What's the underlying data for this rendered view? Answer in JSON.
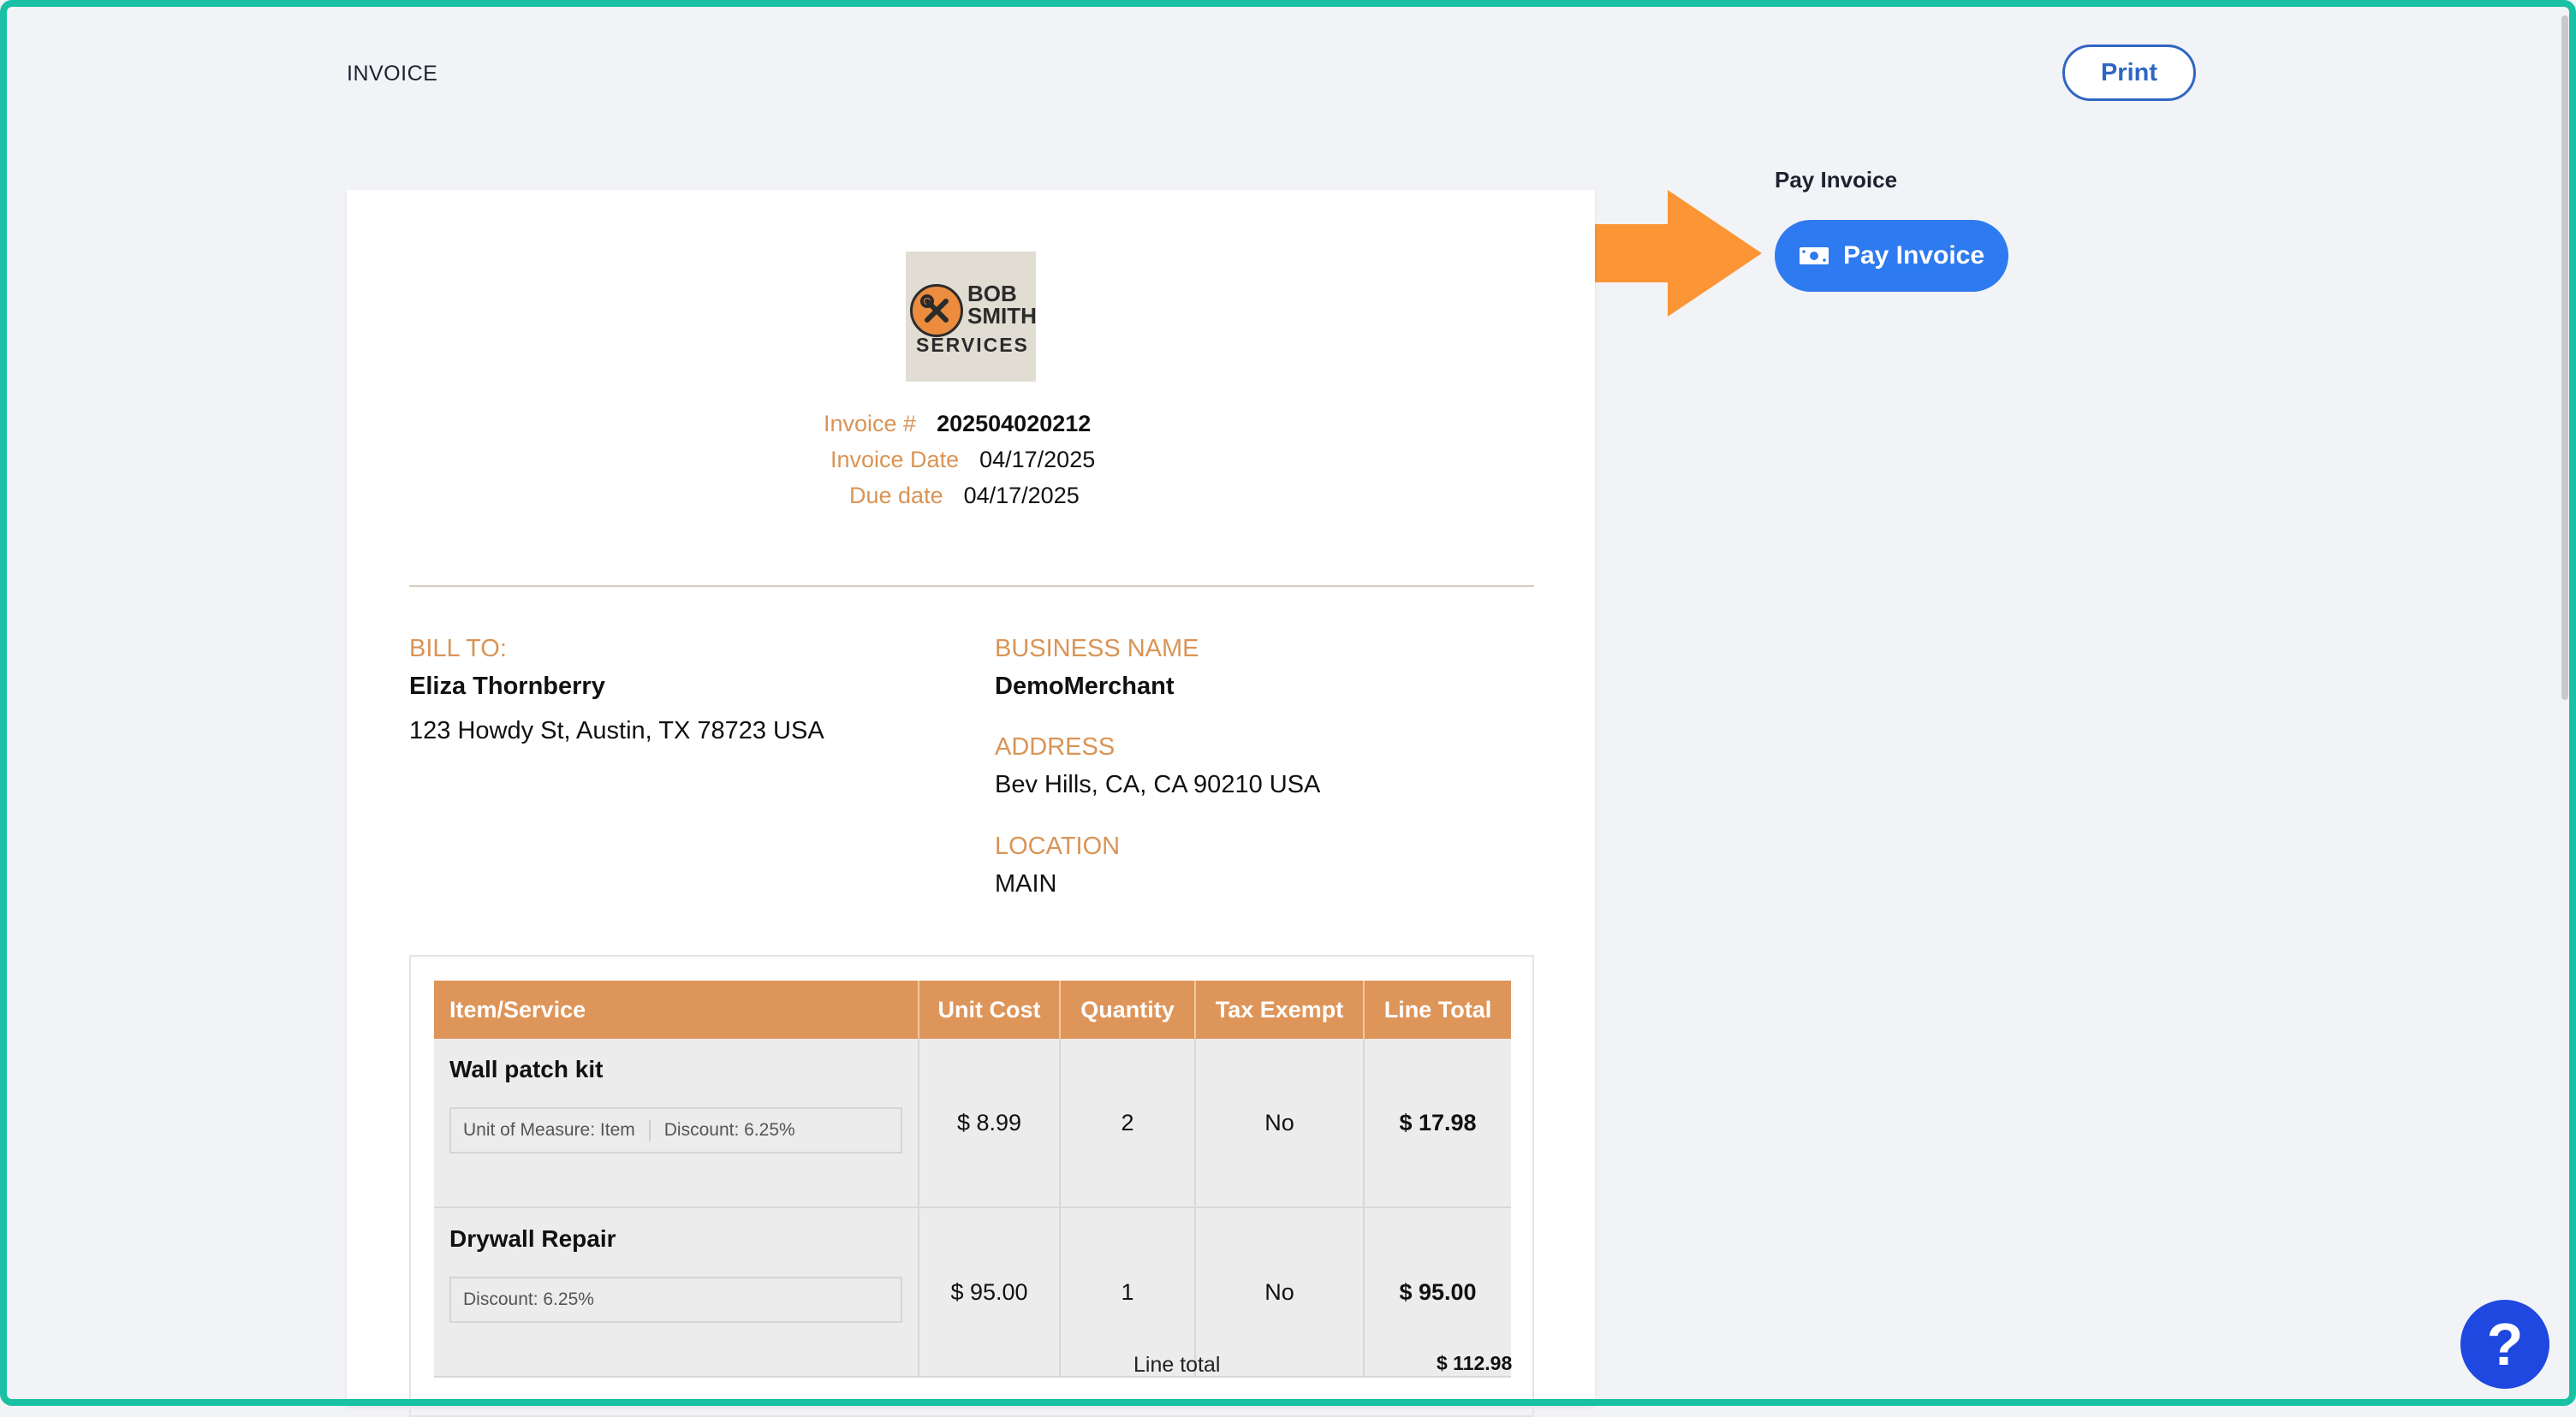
{
  "header": {
    "title": "INVOICE",
    "print_label": "Print"
  },
  "pay": {
    "label": "Pay Invoice",
    "button_label": "Pay Invoice",
    "icon": "money-icon"
  },
  "logo": {
    "line1": "BOB",
    "line2": "SMITH",
    "line3": "SERVICES",
    "icon": "tools-icon"
  },
  "meta": {
    "invoice_number_label": "Invoice #",
    "invoice_number": "202504020212",
    "invoice_date_label": "Invoice Date",
    "invoice_date": "04/17/2025",
    "due_date_label": "Due date",
    "due_date": "04/17/2025"
  },
  "bill_to": {
    "label": "BILL TO:",
    "name": "Eliza Thornberry",
    "address": "123 Howdy St, Austin, TX 78723 USA"
  },
  "business": {
    "name_label": "BUSINESS NAME",
    "name": "DemoMerchant",
    "address_label": "ADDRESS",
    "address": "Bev Hills, CA, CA 90210 USA",
    "location_label": "LOCATION",
    "location": "MAIN"
  },
  "table": {
    "headers": [
      "Item/Service",
      "Unit Cost",
      "Quantity",
      "Tax Exempt",
      "Line Total"
    ],
    "rows": [
      {
        "name": "Wall patch kit",
        "meta1": "Unit of Measure: Item",
        "meta2": "Discount: 6.25%",
        "unit_cost": "$ 8.99",
        "quantity": "2",
        "tax_exempt": "No",
        "line_total": "$ 17.98"
      },
      {
        "name": "Drywall Repair",
        "meta1": "Discount: 6.25%",
        "meta2": "",
        "unit_cost": "$ 95.00",
        "quantity": "1",
        "tax_exempt": "No",
        "line_total": "$ 95.00"
      }
    ]
  },
  "totals": {
    "line_total_label": "Line total",
    "line_total": "$ 112.98"
  },
  "help": {
    "label": "?"
  },
  "colors": {
    "accent": "#2e7af0",
    "orange": "#de9559",
    "arrow": "#fb9535",
    "frame": "#18c1a3"
  }
}
